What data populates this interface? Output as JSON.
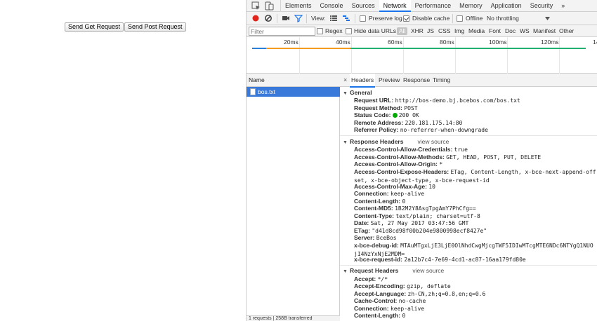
{
  "page": {
    "get_button": "Send Get Request",
    "post_button": "Send Post Request"
  },
  "devtools": {
    "tabs": [
      "Elements",
      "Console",
      "Sources",
      "Network",
      "Performance",
      "Memory",
      "Application",
      "Security"
    ],
    "more_tabs": "»",
    "toolbar": {
      "view_label": "View:",
      "preserve_log": "Preserve log",
      "disable_cache": "Disable cache",
      "offline": "Offline",
      "throttling": "No throttling"
    },
    "filter": {
      "placeholder": "Filter",
      "regex": "Regex",
      "hide_data_urls": "Hide data URLs",
      "types": [
        "All",
        "XHR",
        "JS",
        "CSS",
        "Img",
        "Media",
        "Font",
        "Doc",
        "WS",
        "Manifest",
        "Other"
      ]
    },
    "timeline_ticks": [
      "20ms",
      "40ms",
      "60ms",
      "80ms",
      "100ms",
      "120ms",
      "14"
    ],
    "requests": {
      "column_name": "Name",
      "items": [
        "bos.txt"
      ],
      "status": "1 requests | 258B transferred"
    },
    "details": {
      "tabs": [
        "Headers",
        "Preview",
        "Response",
        "Timing"
      ],
      "general": {
        "title": "General",
        "rows": [
          {
            "k": "Request URL:",
            "v": "http://bos-demo.bj.bcebos.com/bos.txt"
          },
          {
            "k": "Request Method:",
            "v": "POST"
          },
          {
            "k": "Status Code:",
            "v": "200 OK"
          },
          {
            "k": "Remote Address:",
            "v": "220.181.175.14:80"
          },
          {
            "k": "Referrer Policy:",
            "v": "no-referrer-when-downgrade"
          }
        ]
      },
      "response_headers": {
        "title": "Response Headers",
        "view_source": "view source",
        "rows": [
          {
            "k": "Access-Control-Allow-Credentials:",
            "v": "true"
          },
          {
            "k": "Access-Control-Allow-Methods:",
            "v": "GET, HEAD, POST, PUT, DELETE"
          },
          {
            "k": "Access-Control-Allow-Origin:",
            "v": "*"
          },
          {
            "k": "Access-Control-Expose-Headers:",
            "v": "ETag, Content-Length, x-bce-next-append-offset, x-bce-object-type, x-bce-request-id"
          },
          {
            "k": "Access-Control-Max-Age:",
            "v": "10"
          },
          {
            "k": "Connection:",
            "v": "keep-alive"
          },
          {
            "k": "Content-Length:",
            "v": "0"
          },
          {
            "k": "Content-MD5:",
            "v": "1B2M2Y8AsgTpgAmY7PhCfg=="
          },
          {
            "k": "Content-Type:",
            "v": "text/plain; charset=utf-8"
          },
          {
            "k": "Date:",
            "v": "Sat, 27 May 2017 03:47:56 GMT"
          },
          {
            "k": "ETag:",
            "v": "\"d41d8cd98f00b204e9800998ecf8427e\""
          },
          {
            "k": "Server:",
            "v": "BceBos"
          },
          {
            "k": "x-bce-debug-id:",
            "v": "MTAuMTgxLjE3LjE0OlNhdCwgMjcgTWF5IDIwMTcgMTE6NDc6NTYgQ1NUOjI4NzYxNjE2MDM="
          },
          {
            "k": "x-bce-request-id:",
            "v": "2a12b7c4-7e69-4cd1-ac87-16aa179fd80e"
          }
        ]
      },
      "request_headers": {
        "title": "Request Headers",
        "view_source": "view source",
        "rows": [
          {
            "k": "Accept:",
            "v": "*/*"
          },
          {
            "k": "Accept-Encoding:",
            "v": "gzip, deflate"
          },
          {
            "k": "Accept-Language:",
            "v": "zh-CN,zh;q=0.8,en;q=0.6"
          },
          {
            "k": "Cache-Control:",
            "v": "no-cache"
          },
          {
            "k": "Connection:",
            "v": "keep-alive"
          },
          {
            "k": "Content-Length:",
            "v": "0"
          }
        ]
      }
    }
  }
}
